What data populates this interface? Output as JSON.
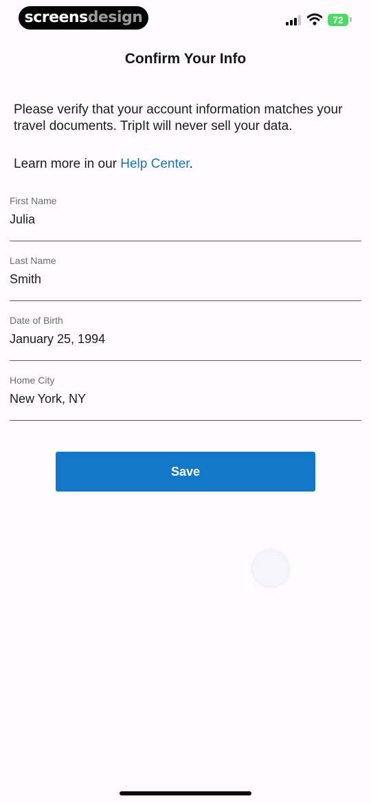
{
  "status_bar": {
    "brand_part1": "screens",
    "brand_part2": "design",
    "battery": "72"
  },
  "header": {
    "title": "Confirm Your Info"
  },
  "intro": {
    "text": "Please verify that your account information matches your travel documents. TripIt will never sell your data.",
    "learn_prefix": "Learn more in our ",
    "learn_link": "Help Center",
    "learn_suffix": "."
  },
  "form": {
    "fields": [
      {
        "label": "First Name",
        "value": "Julia"
      },
      {
        "label": "Last Name",
        "value": "Smith"
      },
      {
        "label": "Date of Birth",
        "value": "January 25, 1994"
      },
      {
        "label": "Home City",
        "value": "New York, NY"
      }
    ],
    "save_label": "Save"
  },
  "colors": {
    "accent": "#1478c8",
    "link": "#1a73b5",
    "battery": "#4cd964",
    "background": "#fdfbfd"
  }
}
